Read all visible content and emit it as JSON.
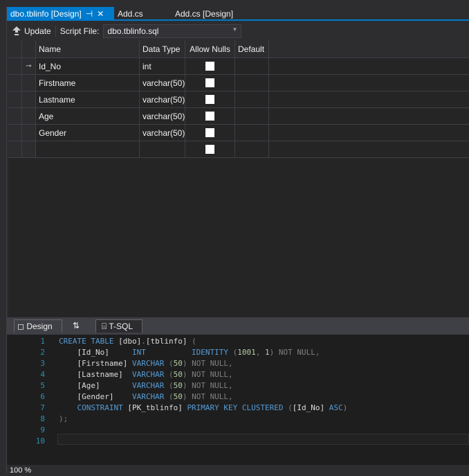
{
  "tabs": [
    {
      "label": "dbo.tblinfo [Design]",
      "pin": "⊣",
      "close": "✕"
    },
    {
      "label": "Add.cs"
    },
    {
      "label": "Add.cs [Design]"
    }
  ],
  "toolbar": {
    "update_label": "Update",
    "script_file_label": "Script File:",
    "script_file_value": "dbo.tblinfo.sql"
  },
  "grid": {
    "headers": [
      "Name",
      "Data Type",
      "Allow Nulls",
      "Default"
    ],
    "rows": [
      {
        "name": "Id_No",
        "type": "int",
        "key": true
      },
      {
        "name": "Firstname",
        "type": "varchar(50)"
      },
      {
        "name": "Lastname",
        "type": "varchar(50)"
      },
      {
        "name": "Age",
        "type": "varchar(50)"
      },
      {
        "name": "Gender",
        "type": "varchar(50)"
      },
      {
        "name": "",
        "type": ""
      }
    ]
  },
  "pane_tabs": {
    "design": "Design",
    "swap": "⇅",
    "tsql": "T-SQL"
  },
  "code": [
    [
      [
        "kw",
        "CREATE TABLE "
      ],
      [
        "id",
        "[dbo]"
      ],
      [
        "pu",
        "."
      ],
      [
        "id",
        "[tblinfo] "
      ],
      [
        "pu",
        "("
      ]
    ],
    [
      [
        "id",
        "    [Id_No]     "
      ],
      [
        "kw",
        "INT          IDENTITY "
      ],
      [
        "pu",
        "("
      ],
      [
        "nu",
        "1001"
      ],
      [
        "pu",
        ", "
      ],
      [
        "nu",
        "1"
      ],
      [
        "pu",
        ") NOT NULL,"
      ]
    ],
    [
      [
        "id",
        "    [Firstname] "
      ],
      [
        "kw",
        "VARCHAR "
      ],
      [
        "pu",
        "("
      ],
      [
        "nu",
        "50"
      ],
      [
        "pu",
        ") NOT NULL,"
      ]
    ],
    [
      [
        "id",
        "    [Lastname]  "
      ],
      [
        "kw",
        "VARCHAR "
      ],
      [
        "pu",
        "("
      ],
      [
        "nu",
        "50"
      ],
      [
        "pu",
        ") NOT NULL,"
      ]
    ],
    [
      [
        "id",
        "    [Age]       "
      ],
      [
        "kw",
        "VARCHAR "
      ],
      [
        "pu",
        "("
      ],
      [
        "nu",
        "50"
      ],
      [
        "pu",
        ") NOT NULL,"
      ]
    ],
    [
      [
        "id",
        "    [Gender]    "
      ],
      [
        "kw",
        "VARCHAR "
      ],
      [
        "pu",
        "("
      ],
      [
        "nu",
        "50"
      ],
      [
        "pu",
        ") NOT NULL,"
      ]
    ],
    [
      [
        "kw",
        "    CONSTRAINT "
      ],
      [
        "id",
        "[PK_tblinfo] "
      ],
      [
        "kw",
        "PRIMARY KEY CLUSTERED "
      ],
      [
        "pu",
        "("
      ],
      [
        "id",
        "[Id_No] "
      ],
      [
        "kw",
        "ASC"
      ],
      [
        "pu",
        ")"
      ]
    ],
    [
      [
        "pu",
        ");"
      ]
    ],
    [],
    []
  ],
  "status": {
    "zoom": "100 %"
  }
}
